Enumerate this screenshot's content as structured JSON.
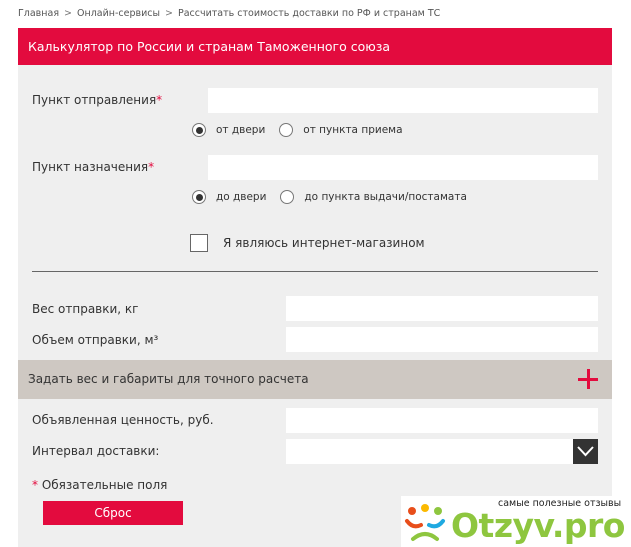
{
  "breadcrumbs": [
    "Главная",
    "Онлайн-сервисы",
    "Рассчитать стоимость доставки по РФ и странам ТС"
  ],
  "breadcrumb_separator": ">",
  "header": {
    "title": "Калькулятор по России и странам Таможенного союза"
  },
  "departure": {
    "label": "Пункт отправления",
    "required_mark": "*",
    "value": "",
    "options": [
      {
        "label": "от двери",
        "selected": true
      },
      {
        "label": "от пункта приема",
        "selected": false
      }
    ]
  },
  "destination": {
    "label": "Пункт назначения",
    "required_mark": "*",
    "value": "",
    "options": [
      {
        "label": "до двери",
        "selected": true
      },
      {
        "label": "до пункта выдачи/постамата",
        "selected": false
      }
    ]
  },
  "online_store": {
    "label": "Я являюсь интернет-магазином",
    "checked": false
  },
  "weight": {
    "label": "Вес отправки, кг",
    "value": ""
  },
  "volume": {
    "label": "Объем отправки, м³",
    "value": ""
  },
  "dimensions_toggle": {
    "label": "Задать вес и габариты для точного расчета"
  },
  "declared_value": {
    "label": "Объявленная ценность, руб.",
    "value": ""
  },
  "delivery_interval": {
    "label": "Интервал доставки:",
    "selected": ""
  },
  "required_note": {
    "mark": "*",
    "text": "Обязательные поля"
  },
  "reset_button": {
    "label": "Сброс"
  },
  "watermark": {
    "tagline": "самые полезные отзывы",
    "brand": "Otzyv.pro"
  },
  "colors": {
    "accent": "#e30b3e",
    "panel_bg": "#efefef",
    "toggle_bg": "#cec8c2",
    "brand_green": "#8ec63f"
  }
}
